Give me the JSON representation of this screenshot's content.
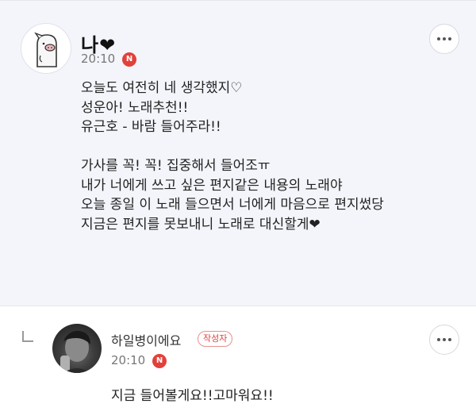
{
  "post": {
    "author": "나❤",
    "time": "20:10",
    "badge": "N",
    "lines": [
      "오늘도 여전히 네 생각했지♡",
      "성운아! 노래추천!!",
      "유근호 - 바람 들어주라!!",
      "",
      "가사를 꼭! 꼭! 집중해서 들어조ㅠ",
      "내가 너에게 쓰고 싶은 편지같은 내용의 노래야",
      "오늘 종일 이 노래 들으면서 너에게 마음으로 편지썼당",
      "지금은 편지를 못보내니 노래로 대신할게❤"
    ]
  },
  "reply": {
    "author": "하일병이에요",
    "tag": "작성자",
    "time": "20:10",
    "badge": "N",
    "text": "지금 들어볼게요!!고마워요!!"
  },
  "colors": {
    "badge": "#e2413b",
    "post_bg": "#f3f5fa"
  }
}
